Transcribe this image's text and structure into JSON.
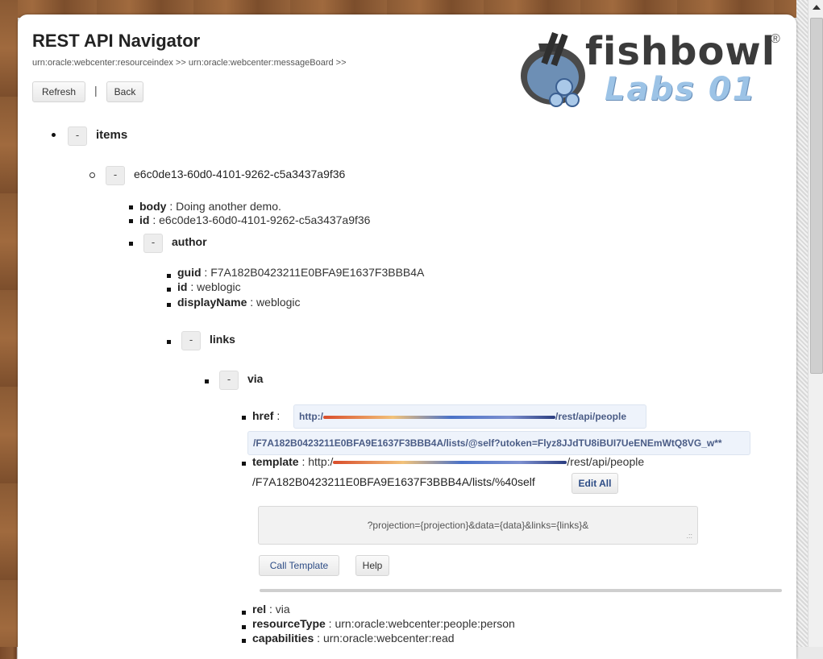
{
  "page": {
    "title": "REST API Navigator",
    "breadcrumb": "urn:oracle:webcenter:resourceindex >> urn:oracle:webcenter:messageBoard >>",
    "refresh_label": "Refresh",
    "separator": "|",
    "back_label": "Back"
  },
  "logo": {
    "name": "fishbowl",
    "registered": "®",
    "subtitle": "Labs 01",
    "icon": "fishbowl-logo-icon"
  },
  "tree": {
    "toggle_label": "-",
    "items_label": "items",
    "entry_id_label": "e6c0de13-60d0-4101-9262-c5a3437a9f36",
    "body_key": "body",
    "body_val": "Doing another demo.",
    "id_key": "id",
    "id_val": "e6c0de13-60d0-4101-9262-c5a3437a9f36",
    "author_label": "author",
    "author": {
      "guid_key": "guid",
      "guid_val": "F7A182B0423211E0BFA9E1637F3BBB4A",
      "id_key": "id",
      "id_val": "weblogic",
      "displayName_key": "displayName",
      "displayName_val": "weblogic"
    },
    "links_label": "links",
    "via_label": "via",
    "via": {
      "href_key": "href",
      "href_part1_start": "http:/",
      "href_part1_end": "/rest/api/people",
      "href_part2": "/F7A182B0423211E0BFA9E1637F3BBB4A/lists/@self?utoken=Flyz8JJdTU8iBUI7UeENEmWtQ8VG_w**",
      "template_key": "template",
      "template_start": "http:/",
      "template_end": "/rest/api/people",
      "template_line2": "/F7A182B0423211E0BFA9E1637F3BBB4A/lists/%40self",
      "edit_all_label": "Edit All",
      "template_params": "?projection={projection}&data={data}&links={links}&",
      "call_template_label": "Call Template",
      "help_label": "Help"
    },
    "rel_key": "rel",
    "rel_val": "via",
    "resourceType_key": "resourceType",
    "resourceType_val": "urn:oracle:webcenter:people:person",
    "capabilities_key": "capabilities",
    "capabilities_val": "urn:oracle:webcenter:read"
  }
}
